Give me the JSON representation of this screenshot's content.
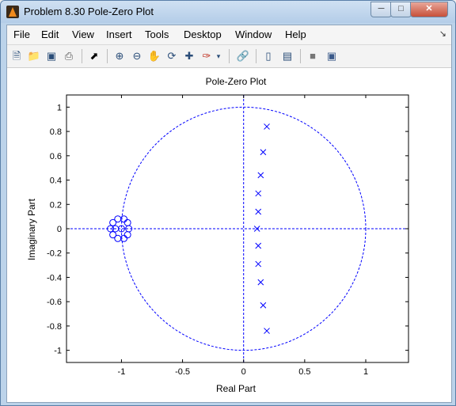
{
  "window": {
    "title": "Problem 8.30 Pole-Zero Plot"
  },
  "menu": [
    "File",
    "Edit",
    "View",
    "Insert",
    "Tools",
    "Desktop",
    "Window",
    "Help"
  ],
  "toolbar_icons": [
    "new-figure-icon",
    "open-file-icon",
    "save-icon",
    "print-icon",
    "edit-plot-arrow-icon",
    "zoom-in-icon",
    "zoom-out-icon",
    "pan-hand-icon",
    "rotate-3d-icon",
    "data-cursor-icon",
    "brush-icon",
    "brush-dropdown-icon",
    "link-plot-icon",
    "insert-colorbar-icon",
    "insert-legend-icon",
    "hide-plot-tools-icon",
    "show-plot-tools-icon"
  ],
  "colors": {
    "plot": "#0000ff",
    "accent": "#f08a1c"
  },
  "chart_data": {
    "type": "scatter",
    "title": "Pole-Zero Plot",
    "xlabel": "Real Part",
    "ylabel": "Imaginary Part",
    "xlim": [
      -1.45,
      1.35
    ],
    "ylim": [
      -1.1,
      1.1
    ],
    "xticks": [
      -1,
      -0.5,
      0,
      0.5,
      1
    ],
    "xtick_labels": [
      "-1",
      "-0.5",
      "0",
      "0.5",
      "1"
    ],
    "yticks": [
      1,
      0.8,
      0.6,
      0.4,
      0.2,
      0,
      -0.2,
      -0.4,
      -0.6,
      -0.8,
      -1
    ],
    "ytick_labels": [
      "1",
      "0.8",
      "0.6",
      "0.4",
      "0.2",
      "0",
      "-0.2",
      "-0.4",
      "-0.6",
      "-0.8",
      "-1"
    ],
    "grid": false,
    "unit_circle": true,
    "series": [
      {
        "marker": "x",
        "points": [
          [
            0.19,
            0.84
          ],
          [
            0.16,
            0.63
          ],
          [
            0.14,
            0.44
          ],
          [
            0.12,
            0.29
          ],
          [
            0.12,
            0.14
          ],
          [
            0.11,
            0.0
          ],
          [
            0.12,
            -0.14
          ],
          [
            0.12,
            -0.29
          ],
          [
            0.14,
            -0.44
          ],
          [
            0.16,
            -0.63
          ],
          [
            0.19,
            -0.84
          ]
        ]
      },
      {
        "marker": "o",
        "points": [
          [
            -1.0,
            0.0
          ],
          [
            -0.95,
            0.05
          ],
          [
            -0.98,
            0.08
          ],
          [
            -1.03,
            0.08
          ],
          [
            -1.07,
            0.05
          ],
          [
            -1.09,
            0.0
          ],
          [
            -1.07,
            -0.05
          ],
          [
            -1.03,
            -0.08
          ],
          [
            -0.98,
            -0.08
          ],
          [
            -0.95,
            -0.05
          ],
          [
            -0.94,
            0.0
          ],
          [
            -1.05,
            0.0
          ]
        ]
      }
    ]
  }
}
